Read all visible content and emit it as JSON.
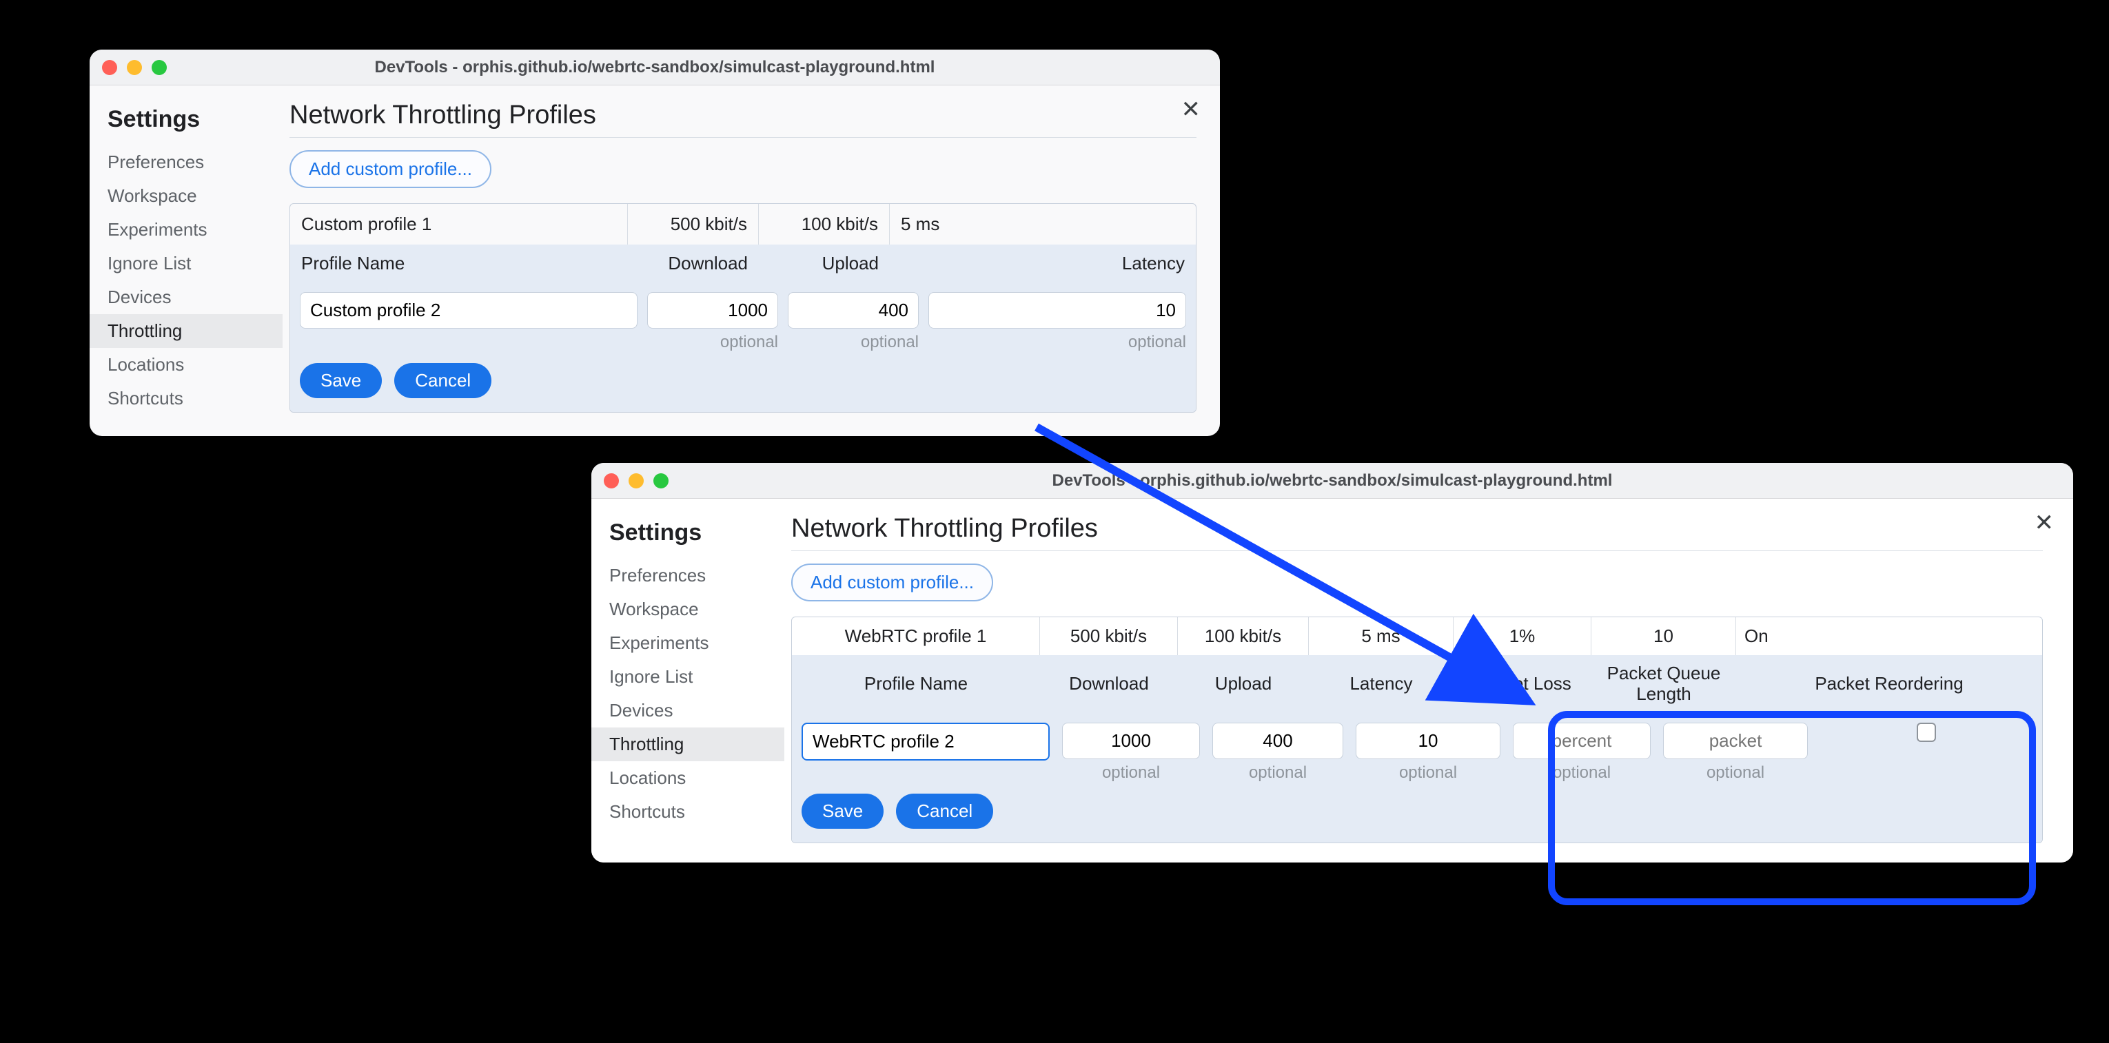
{
  "win_a": {
    "title": "DevTools - orphis.github.io/webrtc-sandbox/simulcast-playground.html",
    "sidebar_title": "Settings",
    "nav": [
      "Preferences",
      "Workspace",
      "Experiments",
      "Ignore List",
      "Devices",
      "Throttling",
      "Locations",
      "Shortcuts"
    ],
    "active_idx": 5,
    "page_title": "Network Throttling Profiles",
    "add_btn": "Add custom profile...",
    "existing": {
      "name": "Custom profile 1",
      "dl": "500 kbit/s",
      "ul": "100 kbit/s",
      "lat": "5 ms"
    },
    "head": {
      "name": "Profile Name",
      "dl": "Download",
      "ul": "Upload",
      "lat": "Latency"
    },
    "edit": {
      "name": "Custom profile 2",
      "dl": "1000",
      "ul": "400",
      "lat": "10"
    },
    "hints": {
      "dl": "optional",
      "ul": "optional",
      "lat": "optional"
    },
    "save": "Save",
    "cancel": "Cancel"
  },
  "win_b": {
    "title": "DevTools - orphis.github.io/webrtc-sandbox/simulcast-playground.html",
    "sidebar_title": "Settings",
    "nav": [
      "Preferences",
      "Workspace",
      "Experiments",
      "Ignore List",
      "Devices",
      "Throttling",
      "Locations",
      "Shortcuts"
    ],
    "active_idx": 5,
    "page_title": "Network Throttling Profiles",
    "add_btn": "Add custom profile...",
    "existing": {
      "name": "WebRTC profile 1",
      "dl": "500 kbit/s",
      "ul": "100 kbit/s",
      "lat": "5 ms",
      "loss": "1%",
      "ql": "10",
      "reord": "On"
    },
    "head": {
      "name": "Profile Name",
      "dl": "Download",
      "ul": "Upload",
      "lat": "Latency",
      "loss": "Packet Loss",
      "ql": "Packet Queue Length",
      "reord": "Packet Reordering"
    },
    "edit": {
      "name": "WebRTC profile 2",
      "dl": "1000",
      "ul": "400",
      "lat": "10",
      "loss": "",
      "ql": "",
      "reord": false
    },
    "ph": {
      "loss": "percent",
      "ql": "packet"
    },
    "hints": {
      "dl": "optional",
      "ul": "optional",
      "lat": "optional",
      "loss": "optional",
      "ql": "optional"
    },
    "save": "Save",
    "cancel": "Cancel"
  }
}
